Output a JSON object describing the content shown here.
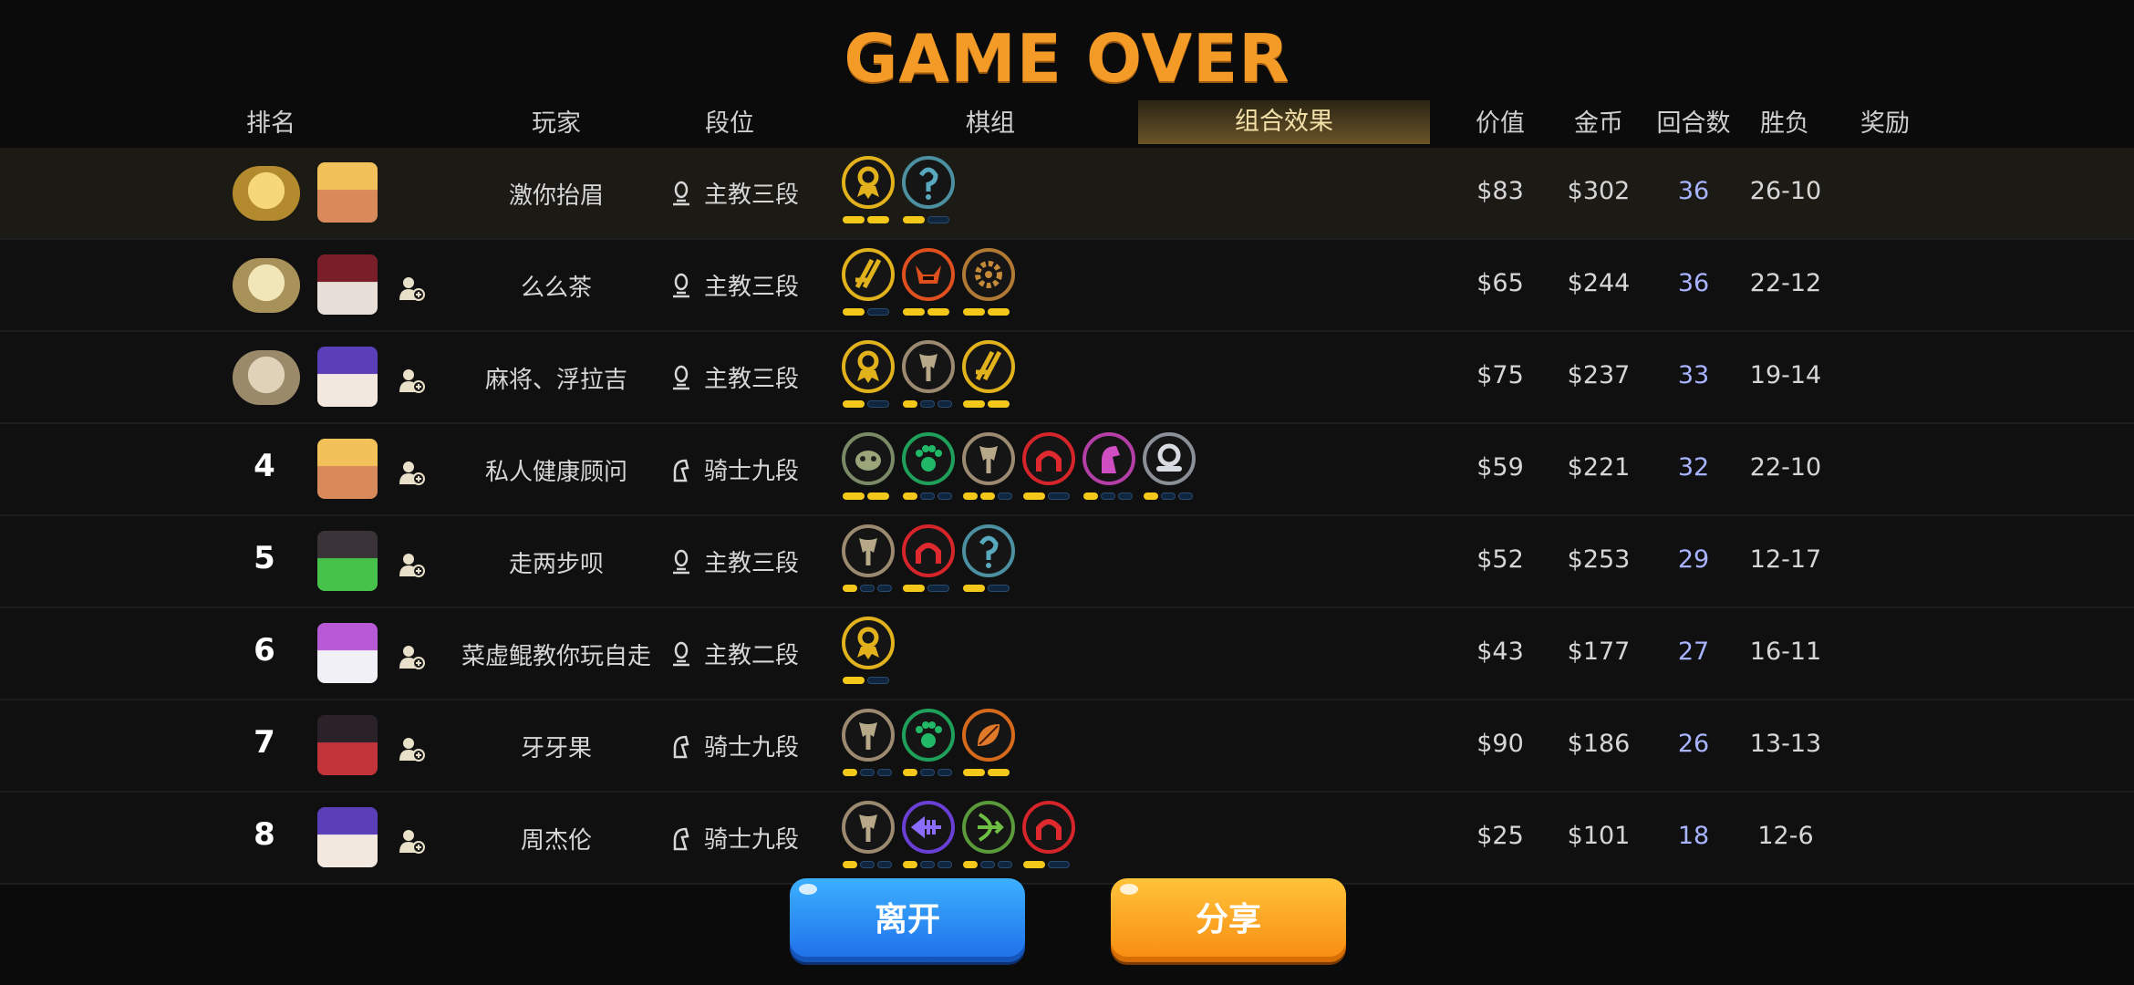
{
  "title": "GAME OVER",
  "headers": {
    "rank": "排名",
    "player": "玩家",
    "tier": "段位",
    "board": "棋组",
    "synergy": "组合效果",
    "value": "价值",
    "gold": "金币",
    "rounds": "回合数",
    "winloss": "胜负",
    "reward": "奖励"
  },
  "colors": {
    "title": "#f39a27",
    "rounds_text": "#a9b4ff",
    "bar_active": "#f3c819",
    "leave_button": "#2a8ff5",
    "share_button": "#fca523"
  },
  "players": [
    {
      "rank": "1",
      "badge": "gold-trophy-badge",
      "avatar": "blonde-hero-avatar",
      "name": "激你抬眉",
      "tier": "主教三段",
      "tier_icon": "bishop-icon",
      "value": "$83",
      "gold": "$302",
      "rounds": "36",
      "winloss": "26-10",
      "traits": [
        {
          "icon": "medal-trait-icon",
          "ring": "#e1b21c",
          "active": 2,
          "total": 2
        },
        {
          "icon": "mage-trait-icon",
          "ring": "#4b8fa0",
          "active": 1,
          "total": 2
        }
      ]
    },
    {
      "rank": "2",
      "badge": "silver-trophy-badge",
      "avatar": "skull-avatar",
      "name": "么么茶",
      "tier": "主教三段",
      "tier_icon": "bishop-icon",
      "value": "$65",
      "gold": "$244",
      "rounds": "36",
      "winloss": "22-12",
      "traits": [
        {
          "icon": "blades-trait-icon",
          "ring": "#e1b21c",
          "active": 1,
          "total": 2
        },
        {
          "icon": "demon-trait-icon",
          "ring": "#e0501e",
          "active": 2,
          "total": 2
        },
        {
          "icon": "gear-trait-icon",
          "ring": "#b07a35",
          "active": 2,
          "total": 2
        }
      ]
    },
    {
      "rank": "3",
      "badge": "bronze-trophy-badge",
      "avatar": "purple-hair-avatar",
      "name": "麻将、浮拉吉",
      "tier": "主教三段",
      "tier_icon": "bishop-icon",
      "value": "$75",
      "gold": "$237",
      "rounds": "33",
      "winloss": "19-14",
      "traits": [
        {
          "icon": "medal-trait-icon",
          "ring": "#e1b21c",
          "active": 1,
          "total": 2
        },
        {
          "icon": "axe-trait-icon",
          "ring": "#9c8a70",
          "active": 1,
          "total": 3
        },
        {
          "icon": "blades-trait-icon",
          "ring": "#e1b21c",
          "active": 2,
          "total": 2
        }
      ]
    },
    {
      "rank": "4",
      "badge": "",
      "avatar": "blonde-hero-avatar",
      "name": "私人健康顾问",
      "tier": "骑士九段",
      "tier_icon": "knight-icon",
      "value": "$59",
      "gold": "$221",
      "rounds": "32",
      "winloss": "22-10",
      "traits": [
        {
          "icon": "beast-trait-icon",
          "ring": "#7a8a66",
          "active": 2,
          "total": 2
        },
        {
          "icon": "paw-trait-icon",
          "ring": "#1fa05a",
          "active": 1,
          "total": 3
        },
        {
          "icon": "axe-trait-icon",
          "ring": "#9c8a70",
          "active": 2,
          "total": 3
        },
        {
          "icon": "arch-trait-icon",
          "ring": "#d6252a",
          "active": 1,
          "total": 2
        },
        {
          "icon": "horse-trait-icon",
          "ring": "#b23ea6",
          "active": 1,
          "total": 3
        },
        {
          "icon": "helm-trait-icon",
          "ring": "#8a8f98",
          "active": 1,
          "total": 3
        }
      ]
    },
    {
      "rank": "5",
      "badge": "",
      "avatar": "green-mohawk-avatar",
      "name": "走两步呗",
      "tier": "主教三段",
      "tier_icon": "bishop-icon",
      "value": "$52",
      "gold": "$253",
      "rounds": "29",
      "winloss": "12-17",
      "traits": [
        {
          "icon": "axe-trait-icon",
          "ring": "#9c8a70",
          "active": 1,
          "total": 3
        },
        {
          "icon": "arch-trait-icon",
          "ring": "#d6252a",
          "active": 1,
          "total": 2
        },
        {
          "icon": "mage-trait-icon",
          "ring": "#4b8fa0",
          "active": 1,
          "total": 2
        }
      ]
    },
    {
      "rank": "6",
      "badge": "",
      "avatar": "dragon-avatar",
      "name": "菜虚鲲教你玩自走",
      "tier": "主教二段",
      "tier_icon": "bishop-icon",
      "value": "$43",
      "gold": "$177",
      "rounds": "27",
      "winloss": "16-11",
      "traits": [
        {
          "icon": "medal-trait-icon",
          "ring": "#e1b21c",
          "active": 1,
          "total": 2
        }
      ]
    },
    {
      "rank": "7",
      "badge": "",
      "avatar": "ninja-avatar",
      "name": "牙牙果",
      "tier": "骑士九段",
      "tier_icon": "knight-icon",
      "value": "$90",
      "gold": "$186",
      "rounds": "26",
      "winloss": "13-13",
      "traits": [
        {
          "icon": "axe-trait-icon",
          "ring": "#9c8a70",
          "active": 1,
          "total": 3
        },
        {
          "icon": "paw-trait-icon",
          "ring": "#1fa05a",
          "active": 1,
          "total": 3
        },
        {
          "icon": "leaf-trait-icon",
          "ring": "#d66a1c",
          "active": 2,
          "total": 2
        }
      ]
    },
    {
      "rank": "8",
      "badge": "",
      "avatar": "purple-hair-avatar",
      "name": "周杰伦",
      "tier": "骑士九段",
      "tier_icon": "knight-icon",
      "value": "$25",
      "gold": "$101",
      "rounds": "18",
      "winloss": "12-6",
      "traits": [
        {
          "icon": "axe-trait-icon",
          "ring": "#9c8a70",
          "active": 1,
          "total": 3
        },
        {
          "icon": "fish-trait-icon",
          "ring": "#6a3fd6",
          "active": 1,
          "total": 3
        },
        {
          "icon": "bow-trait-icon",
          "ring": "#5a9a3a",
          "active": 1,
          "total": 3
        },
        {
          "icon": "arch-trait-icon",
          "ring": "#d6252a",
          "active": 1,
          "total": 2
        }
      ]
    }
  ],
  "buttons": {
    "leave": "离开",
    "share": "分享"
  }
}
